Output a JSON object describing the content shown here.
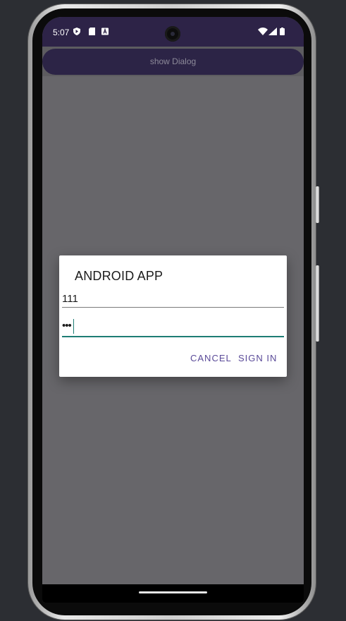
{
  "status_bar": {
    "time": "5:07",
    "icons": [
      "shield-icon",
      "sd-card-icon",
      "a-icon"
    ],
    "right_icons": [
      "wifi-icon",
      "signal-icon",
      "battery-icon"
    ]
  },
  "main": {
    "show_dialog_label": "show Dialog"
  },
  "dialog": {
    "title": "ANDROID APP",
    "username_value": "111",
    "password_value": "•••",
    "cancel_label": "CANCEL",
    "sign_in_label": "SIGN IN"
  },
  "colors": {
    "status_bar_bg": "#2d2347",
    "accent": "#5a4a98",
    "focus_underline": "#1e7d74",
    "scrim": "#67666a"
  }
}
